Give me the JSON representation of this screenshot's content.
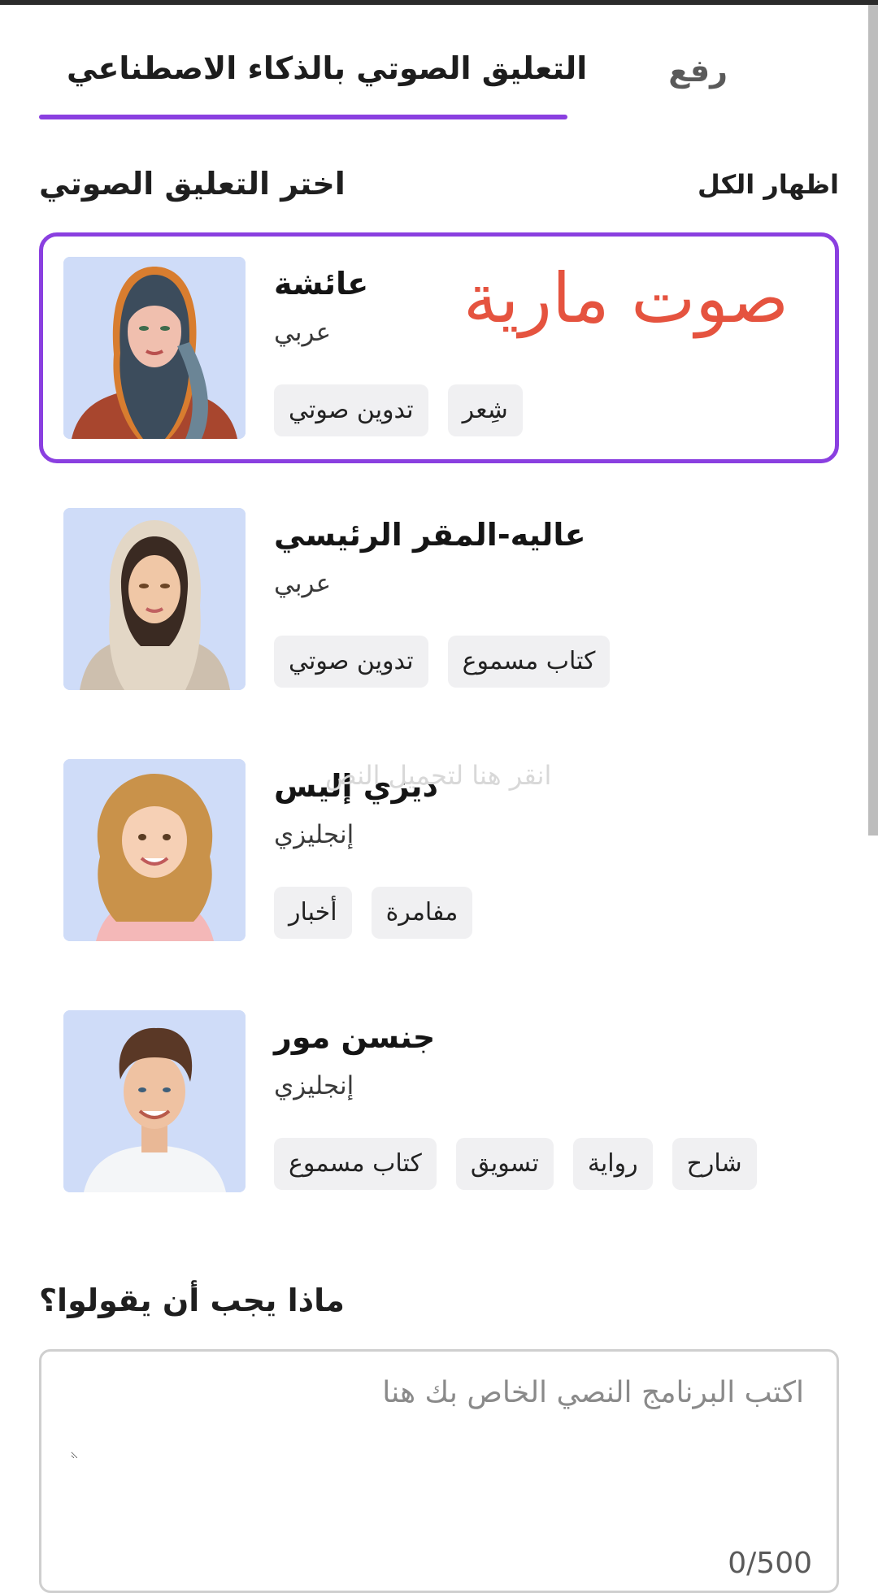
{
  "tabs": {
    "upload": "رفع",
    "ai_voice": "التعليق الصوتي بالذكاء الاصطناعي"
  },
  "section": {
    "title": "اختر التعليق الصوتي",
    "show_all": "اظهار الكل"
  },
  "voices": [
    {
      "name": "عائشة",
      "language": "عربي",
      "tags": [
        "تدوين صوتي",
        "شِعر"
      ],
      "selected": true
    },
    {
      "name": "عاليه-المقر الرئيسي",
      "language": "عربي",
      "tags": [
        "تدوين صوتي",
        "كتاب مسموع"
      ]
    },
    {
      "name": "ديزي إليس",
      "language": "إنجليزي",
      "tags": [
        "أخبار",
        "مفامرة"
      ]
    },
    {
      "name": "جنسن مور",
      "language": "إنجليزي",
      "tags": [
        "كتاب مسموع",
        "تسويق",
        "رواية",
        "شارح"
      ]
    }
  ],
  "overlay": {
    "voice_caption": "صوت مارية",
    "hint": "انقر هنا لتحميل النص"
  },
  "script": {
    "label": "ماذا يجب أن يقولوا؟",
    "placeholder": "اكتب البرنامج النصي الخاص بك هنا",
    "counter": "0/500"
  },
  "colors": {
    "accent": "#8a3fe0",
    "caption": "#e5533f",
    "avatar_bg": "#cfdcf8"
  }
}
